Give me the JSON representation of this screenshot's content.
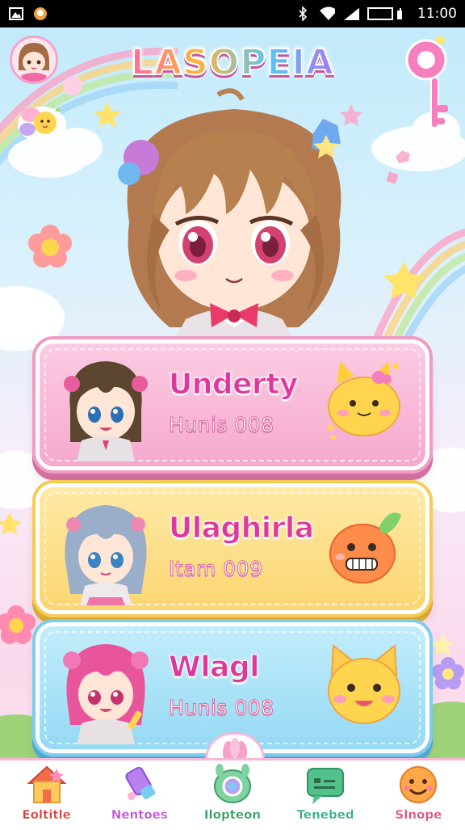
{
  "status_bar": {
    "time": "11:00",
    "left_icons": [
      "app-icon",
      "notification-icon"
    ],
    "right_icons": [
      "bluetooth-icon",
      "wifi-icon",
      "signal-icon",
      "battery-icon"
    ]
  },
  "header": {
    "title": "LASOPEIA",
    "profile_icon": "avatar",
    "right_icon": "key-icon"
  },
  "cards": [
    {
      "name": "Underty",
      "subtitle": "Hunis 008",
      "theme": "pink",
      "pet_icon": "yellow-cat-pet-icon"
    },
    {
      "name": "Ulaghirla",
      "subtitle": "Itam 009",
      "theme": "yellow",
      "pet_icon": "orange-blob-pet-icon"
    },
    {
      "name": "Wlagl",
      "subtitle": "Hunis 008",
      "theme": "blue",
      "pet_icon": "cat-face-pet-icon"
    }
  ],
  "nav": [
    {
      "label": "Eoltitle",
      "icon": "house-icon",
      "color": "#e0403c"
    },
    {
      "label": "Nentoes",
      "icon": "potion-icon",
      "color": "#c04ad6"
    },
    {
      "label": "Ilopteon",
      "icon": "creature-icon",
      "color": "#2f9a5a"
    },
    {
      "label": "Tenebed",
      "icon": "chat-icon",
      "color": "#2fae7e"
    },
    {
      "label": "Slnope",
      "icon": "smiley-icon",
      "color": "#e84a6e"
    }
  ],
  "colors": {
    "pink_card": "#f9bcd9",
    "yellow_card": "#fde28a",
    "blue_card": "#a9e3f7",
    "accent": "#e0379a"
  }
}
